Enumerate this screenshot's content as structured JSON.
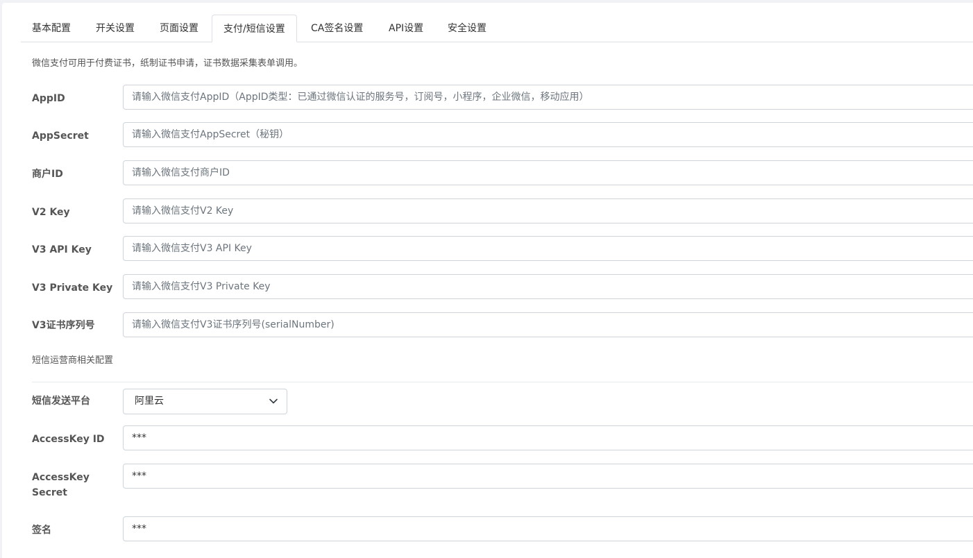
{
  "tabs": [
    {
      "label": "基本配置"
    },
    {
      "label": "开关设置"
    },
    {
      "label": "页面设置"
    },
    {
      "label": "支付/短信设置"
    },
    {
      "label": "CA签名设置"
    },
    {
      "label": "API设置"
    },
    {
      "label": "安全设置"
    }
  ],
  "active_tab": "支付/短信设置",
  "wechat_hint": "微信支付可用于付费证书，纸制证书申请，证书数据采集表单调用。",
  "wechat_fields": [
    {
      "label": "AppID",
      "placeholder": "请输入微信支付AppID（AppID类型：已通过微信认证的服务号，订阅号，小程序，企业微信，移动应用）"
    },
    {
      "label": "AppSecret",
      "placeholder": "请输入微信支付AppSecret（秘钥）"
    },
    {
      "label": "商户ID",
      "placeholder": "请输入微信支付商户ID"
    },
    {
      "label": "V2 Key",
      "placeholder": "请输入微信支付V2 Key"
    },
    {
      "label": "V3 API Key",
      "placeholder": "请输入微信支付V3 API Key"
    },
    {
      "label": "V3 Private Key",
      "placeholder": "请输入微信支付V3 Private Key"
    },
    {
      "label": "V3证书序列号",
      "placeholder": "请输入微信支付V3证书序列号(serialNumber)"
    }
  ],
  "sms_hint": "短信运营商相关配置",
  "sms_platform": {
    "label": "短信发送平台",
    "value": "阿里云"
  },
  "sms_fields": [
    {
      "label": "AccessKey ID",
      "value": "***"
    },
    {
      "label": "AccessKey Secret",
      "value": "***"
    },
    {
      "label": "签名",
      "value": "***"
    }
  ]
}
